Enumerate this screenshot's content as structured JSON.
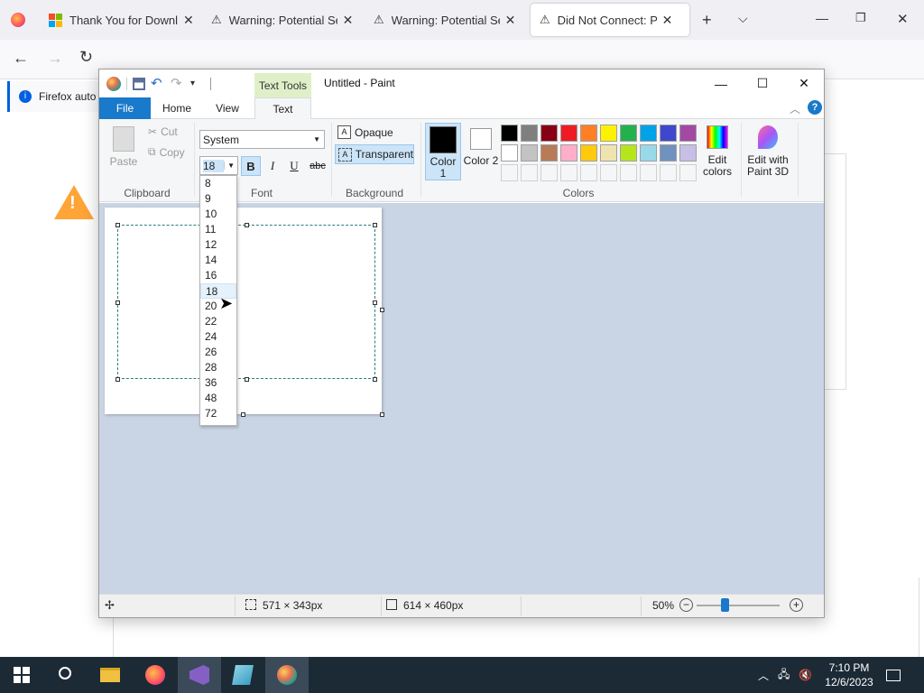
{
  "browser": {
    "tabs": [
      {
        "title": "Thank You for Downlo",
        "icon": "windows-logo-icon"
      },
      {
        "title": "Warning: Potential Sec",
        "icon": "warning-icon"
      },
      {
        "title": "Warning: Potential Sec",
        "icon": "warning-icon"
      },
      {
        "title": "Did Not Connect: Pote",
        "icon": "warning-icon",
        "active": true
      }
    ],
    "notification": "Firefox auto"
  },
  "paint": {
    "title": "Untitled - Paint",
    "context_tab": "Text Tools",
    "tabs": [
      "File",
      "Home",
      "View",
      "Text"
    ],
    "clipboard": {
      "paste": "Paste",
      "cut": "Cut",
      "copy": "Copy",
      "label": "Clipboard"
    },
    "font": {
      "family": "System",
      "size": "18",
      "bold": "B",
      "italic": "I",
      "underline": "U",
      "strike": "abc",
      "label": "Font"
    },
    "background": {
      "opaque": "Opaque",
      "transparent": "Transparent",
      "label": "Background"
    },
    "colors": {
      "color1": "Color 1",
      "color2": "Color 2",
      "edit": "Edit colors",
      "paint3d": "Edit with Paint 3D",
      "label": "Colors",
      "palette_row1": [
        "#000000",
        "#7f7f7f",
        "#880015",
        "#ed1c24",
        "#ff7f27",
        "#fff200",
        "#22b14c",
        "#00a2e8",
        "#3f48cc",
        "#a349a4"
      ],
      "palette_row2": [
        "#ffffff",
        "#c3c3c3",
        "#b97a57",
        "#ffaec9",
        "#ffc90e",
        "#efe4b0",
        "#b5e61d",
        "#99d9ea",
        "#7092be",
        "#c8bfe7"
      ]
    },
    "font_sizes": [
      "8",
      "9",
      "10",
      "11",
      "12",
      "14",
      "16",
      "18",
      "20",
      "22",
      "24",
      "26",
      "28",
      "36",
      "48",
      "72"
    ],
    "selected_size": "18",
    "status": {
      "selection": "571 × 343px",
      "image": "614 × 460px",
      "zoom": "50%"
    }
  },
  "taskbar": {
    "time": "7:10 PM",
    "date": "12/6/2023"
  }
}
